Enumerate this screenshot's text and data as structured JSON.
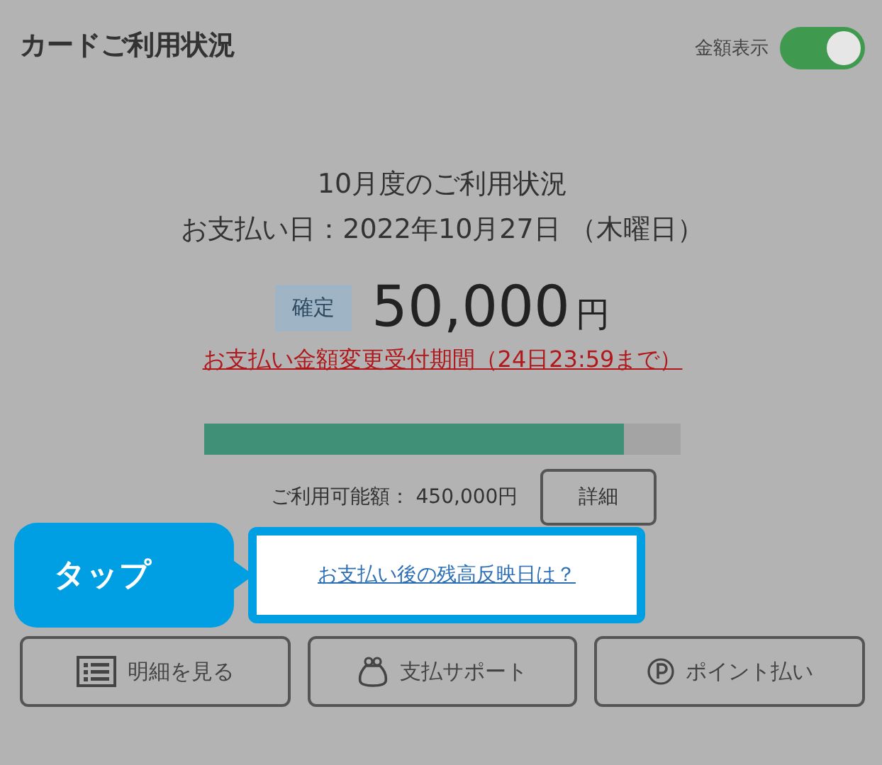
{
  "header": {
    "title": "カードご利用状況",
    "toggle_label": "金額表示",
    "toggle_on": true
  },
  "summary": {
    "month": "10月度のご利用状況",
    "payment_date": "お支払い日：2022年10月27日 （木曜日）",
    "status_tag": "確定",
    "amount": "50,000",
    "currency": "円",
    "change_link": "お支払い金額変更受付期間（24日23:59まで）"
  },
  "usage": {
    "level": 0.88,
    "available": "ご利用可能額： 450,000円",
    "detail_button": "詳細"
  },
  "callout": {
    "label": "タップ",
    "link": "お支払い後の残高反映日は？"
  },
  "buttons": [
    {
      "kind": "list",
      "label": "明細を見る"
    },
    {
      "kind": "purse",
      "label": "支払サポート"
    },
    {
      "kind": "point",
      "label": "ポイント払い"
    }
  ]
}
